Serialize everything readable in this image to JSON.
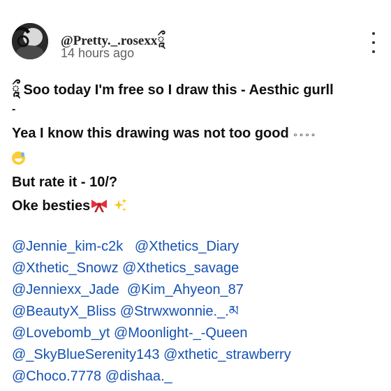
{
  "comment": {
    "author": "@Pretty._.rosexxཱྀ",
    "timestamp": "14 hours ago",
    "menu_icon": "more-vertical-icon",
    "lines": {
      "l1": "ཱྀ Soo today I'm free so I draw this - Aesthic gurll",
      "l2": "-",
      "l3": "Yea I know this drawing was not too good",
      "l3_dots": "∘∘∘∘",
      "l4": "But rate it - 10/?",
      "l5": "Oke besties"
    },
    "emojis": [
      "grinning-sweat-emoji",
      "ribbon-emoji",
      "sparkles-emoji"
    ],
    "mentions": [
      [
        "@Jennie_kim-c2k",
        "@Xthetics_Diary"
      ],
      [
        "@Xthetic_Snowz",
        "@Xthetics_savage"
      ],
      [
        "@Jenniexx_Jade",
        "@Kim_Ahyeon_87"
      ],
      [
        "@BeautyX_Bliss",
        "@Strwxwonnie._.མ"
      ],
      [
        "@Lovebomb_yt",
        "@Moonlight-_-Queen"
      ],
      [
        "@_SkyBlueSerenity143",
        "@xthetic_strawberry"
      ],
      [
        "@Choco.7778",
        "@dishaa._"
      ]
    ],
    "colors": {
      "mention": "#1552b3",
      "text": "#0f0f0f",
      "meta": "#606060"
    }
  }
}
